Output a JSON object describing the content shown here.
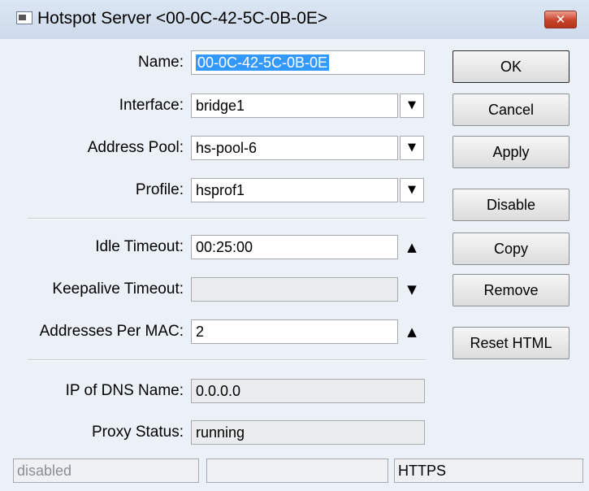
{
  "window": {
    "title": "Hotspot Server <00-0C-42-5C-0B-0E>",
    "close_glyph": "✕"
  },
  "form": {
    "name": {
      "label": "Name:",
      "value": "00-0C-42-5C-0B-0E"
    },
    "interface": {
      "label": "Interface:",
      "value": "bridge1"
    },
    "address_pool": {
      "label": "Address Pool:",
      "value": "hs-pool-6"
    },
    "profile": {
      "label": "Profile:",
      "value": "hsprof1"
    },
    "idle_timeout": {
      "label": "Idle Timeout:",
      "value": "00:25:00"
    },
    "keepalive_timeout": {
      "label": "Keepalive Timeout:",
      "value": ""
    },
    "addresses_per_mac": {
      "label": "Addresses Per MAC:",
      "value": "2"
    },
    "ip_of_dns_name": {
      "label": "IP of DNS Name:",
      "value": "0.0.0.0"
    },
    "proxy_status": {
      "label": "Proxy Status:",
      "value": "running"
    },
    "dropdown_glyph": "▼",
    "up_glyph": "▲",
    "down_glyph": "▼"
  },
  "buttons": {
    "ok": "OK",
    "cancel": "Cancel",
    "apply": "Apply",
    "disable": "Disable",
    "copy": "Copy",
    "remove": "Remove",
    "reset_html": "Reset HTML"
  },
  "statusbar": {
    "state": "disabled",
    "middle": "",
    "protocol": "HTTPS"
  },
  "colors": {
    "selection": "#3399ff",
    "window_bg": "#ecf1f8",
    "close_button": "#c8432a"
  }
}
